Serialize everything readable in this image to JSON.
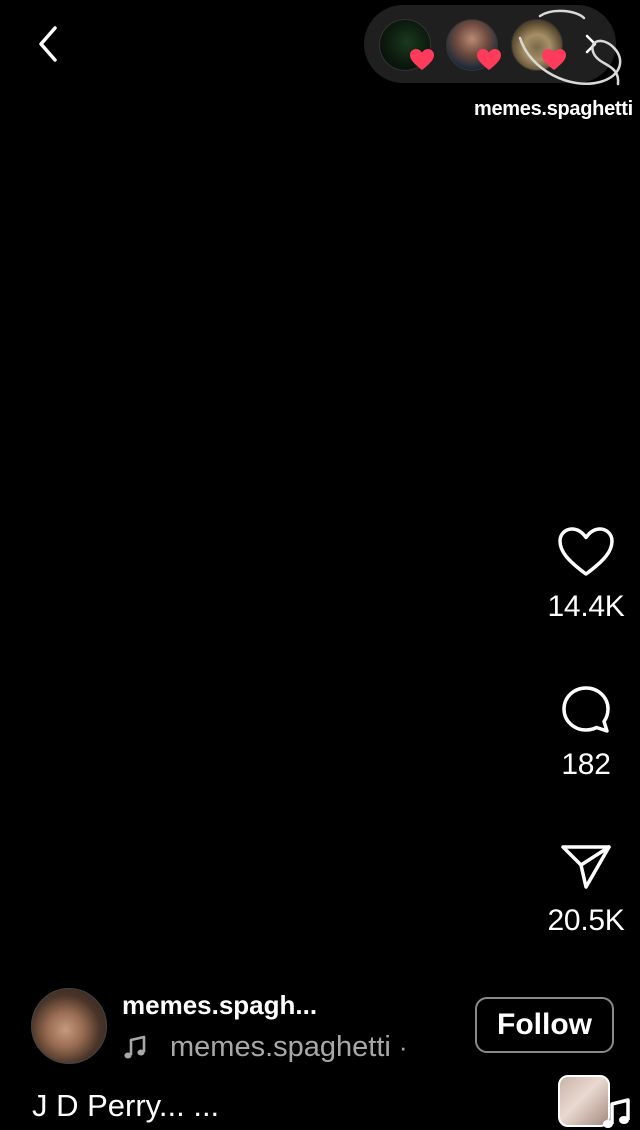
{
  "header": {
    "watermark": "memes.spaghetti"
  },
  "actions": {
    "likes": "14.4K",
    "comments": "182",
    "shares": "20.5K"
  },
  "post": {
    "username": "memes.spagh...",
    "audio_name": "memes.spaghetti",
    "audio_separator": "·",
    "follow_label": "Follow",
    "caption": "J D Perry... ..."
  },
  "icons": {
    "back": "chevron-left-icon",
    "forward": "chevron-right-icon",
    "like": "heart-outline-icon",
    "comment": "speech-bubble-icon",
    "share": "paper-plane-icon",
    "music": "music-note-icon"
  },
  "colors": {
    "background": "#000000",
    "text": "#ffffff",
    "muted_text": "#a8a8a8",
    "heart_badge": "#ff3b5c"
  }
}
